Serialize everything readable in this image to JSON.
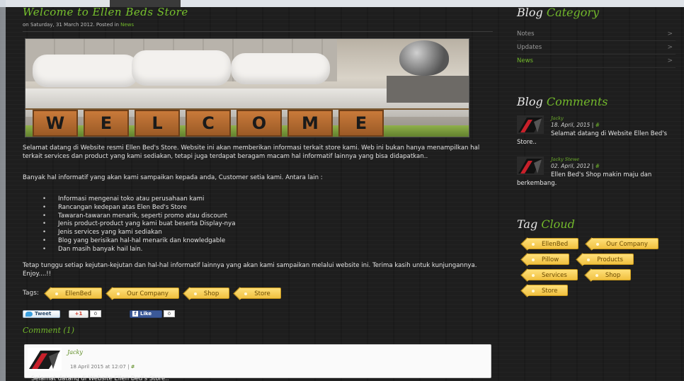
{
  "post": {
    "title": "Welcome to Ellen Beds Store",
    "meta_prefix": "on Saturday, 31 March 2012. Posted in",
    "meta_category": "News",
    "hero_letters": [
      "W",
      "E",
      "L",
      "C",
      "O",
      "M",
      "E"
    ],
    "paragraph1": "Selamat datang di Website resmi Ellen Bed's Store. Website ini akan memberikan informasi terkait store kami. Web ini bukan hanya menampilkan hal terkait services dan product yang kami sediakan, tetapi juga terdapat beragam macam hal informatif lainnya yang bisa didapatkan..",
    "paragraph2": "Banyak hal informatif yang akan kami sampaikan kepada anda, Customer setia kami. Antara lain :",
    "bullets": [
      "Informasi mengenai toko atau perusahaan kami",
      "Rancangan kedepan atas Elen Bed's Store",
      "Tawaran-tawaran menarik, seperti promo atau discount",
      "Jenis product-product yang kami buat beserta Display-nya",
      "Jenis services yang kami sediakan",
      "Blog yang berisikan hal-hal menarik dan knowledgable",
      "Dan masih banyak hail lain."
    ],
    "paragraph3": "Tetap tunggu setiap kejutan-kejutan dan hal-hal informatif lainnya yang akan kami sampaikan melalui website ini. Terima kasih untuk kunjungannya. Enjoy....!!",
    "tags_label": "Tags:",
    "tags": [
      "EllenBed",
      "Our Company",
      "Shop",
      "Store"
    ]
  },
  "share": {
    "tweet_label": "Tweet",
    "gplus_label": "+1",
    "gplus_count": "0",
    "like_label": "Like",
    "like_count": "0"
  },
  "comments": {
    "heading": "Comment (1)",
    "items": [
      {
        "author": "Jacky",
        "date": "18 April 2015 at 12:07",
        "permalink": "#",
        "text": "Selamat datang di Website Ellen Bed's Store.."
      }
    ]
  },
  "sidebar": {
    "category_title_a": "Blog",
    "category_title_b": "Category",
    "categories": [
      {
        "label": "Notes",
        "active": false
      },
      {
        "label": "Updates",
        "active": false
      },
      {
        "label": "News",
        "active": true
      }
    ],
    "comments_title_a": "Blog",
    "comments_title_b": "Comments",
    "recent_comments": [
      {
        "author": "Jacky",
        "date": "18. April, 2015",
        "permalink": "#",
        "text": "Selamat datang di Website Ellen Bed's Store.."
      },
      {
        "author": "Jacky Stewe",
        "date": "02. April, 2012",
        "permalink": "#",
        "text": "Ellen Bed's Shop makin maju dan berkembang."
      }
    ],
    "cloud_title_a": "Tag",
    "cloud_title_b": "Cloud",
    "cloud_tags": [
      "EllenBed",
      "Our Company",
      "Pillow",
      "Products",
      "Services",
      "Shop",
      "Store"
    ]
  },
  "colors": {
    "accent": "#72b82b",
    "tag_bg": "#f0c040",
    "background": "#1e1e1e"
  }
}
